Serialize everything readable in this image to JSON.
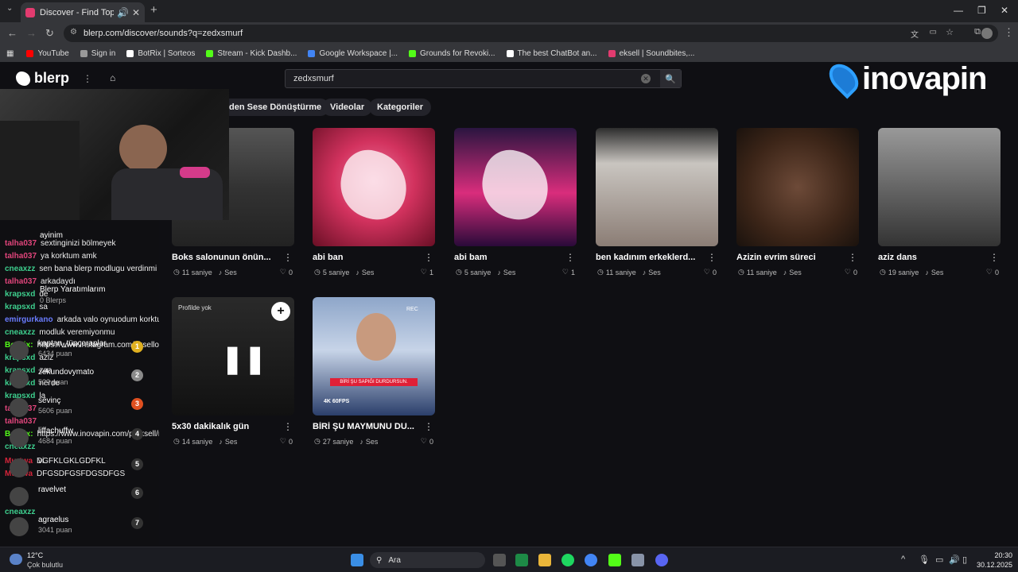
{
  "browser": {
    "tab_title": "Discover - Find Top Blerps,",
    "url": "blerp.com/discover/sounds?q=zedxsmurf",
    "bookmarks": [
      {
        "label": "YouTube",
        "color": "#ff0000"
      },
      {
        "label": "Sign in",
        "color": "#999999"
      },
      {
        "label": "BotRix | Sorteos",
        "color": "#ffffff"
      },
      {
        "label": "Stream - Kick Dashb...",
        "color": "#53fc18"
      },
      {
        "label": "Google Workspace |...",
        "color": "#4285f4"
      },
      {
        "label": "Grounds for Revoki...",
        "color": "#53fc18"
      },
      {
        "label": "The best ChatBot an...",
        "color": "#ffffff"
      },
      {
        "label": "eksell | Soundbites,...",
        "color": "#e23b6f"
      }
    ]
  },
  "site": {
    "logo": "blerp",
    "search_value": "zedxsmurf",
    "pills": [
      "den Sese Dönüştürme",
      "Videolar",
      "Kategoriler"
    ],
    "overlay_brand": "inovapin"
  },
  "cards": [
    {
      "title": "Boks salonunun önün...",
      "duration": "11 saniye",
      "type": "Ses",
      "likes": "0"
    },
    {
      "title": "abi ban",
      "duration": "5 saniye",
      "type": "Ses",
      "likes": "1"
    },
    {
      "title": "abi bam",
      "duration": "5 saniye",
      "type": "Ses",
      "likes": "1"
    },
    {
      "title": "ben kadınım erkeklerd...",
      "duration": "11 saniye",
      "type": "Ses",
      "likes": "0"
    },
    {
      "title": "Azizin evrim süreci",
      "duration": "11 saniye",
      "type": "Ses",
      "likes": "0"
    },
    {
      "title": "aziz dans",
      "duration": "19 saniye",
      "type": "Ses",
      "likes": "0"
    },
    {
      "title": "5x30 dakikalık gün",
      "duration": "14 saniye",
      "type": "Ses",
      "likes": "0",
      "badge": "Profilde yok"
    },
    {
      "title": "BİRİ ŞU MAYMUNU DU...",
      "duration": "27 saniye",
      "type": "Ses",
      "likes": "0",
      "caption": "BİRİ ŞU SAPIĞI DURDURSUN.",
      "res": "4K 60FPS",
      "rec": "REC"
    }
  ],
  "chat": [
    {
      "user": "talha037",
      "msg": "sextinginizi bölmeyek",
      "color": "#e0457b"
    },
    {
      "user": "talha037",
      "msg": "ya korktum amk",
      "color": "#e0457b"
    },
    {
      "user": "cneaxzz",
      "msg": "sen bana blerp modlugu verdinmi",
      "color": "#3ecf8e"
    },
    {
      "user": "talha037",
      "msg": "arkadaydı",
      "color": "#e0457b"
    },
    {
      "user": "krapsxd",
      "msg": "de",
      "color": "#3ecf8e"
    },
    {
      "user": "krapsxd",
      "msg": "sa",
      "color": "#3ecf8e"
    },
    {
      "user": "emirgurkano",
      "msg": "arkada valo oynuodum korktum",
      "color": "#6a7cff"
    },
    {
      "user": "cneaxzz",
      "msg": "modluk veremiyonmu",
      "color": "#3ecf8e"
    },
    {
      "user": "BotRix:",
      "msg": "https://www.instagram.com/eksellol/ Takip etmeyi unutma",
      "color": "#53fc18"
    },
    {
      "user": "krapsxd",
      "msg": "aziz",
      "color": "#3ecf8e"
    },
    {
      "user": "krapsxd",
      "msg": "zaa",
      "color": "#3ecf8e"
    },
    {
      "user": "krapsxd",
      "msg": "nerde",
      "color": "#3ecf8e"
    },
    {
      "user": "krapsxd",
      "msg": "la",
      "color": "#3ecf8e"
    },
    {
      "user": "talha037",
      "msg": "",
      "color": "#e0457b"
    },
    {
      "user": "talha037",
      "msg": "",
      "color": "#e0457b"
    },
    {
      "user": "BotRix:",
      "msg": "https://www.inovapin.com/p/eksell/ref Ucuz Pin için tıkla",
      "color": "#53fc18"
    },
    {
      "user": "cneaxzz",
      "msg": "",
      "color": "#3ecf8e"
    },
    {
      "user": "Murtwa",
      "msg": "DGFKLGKLGDFKL",
      "color": "#d4243a"
    },
    {
      "user": "Murtwa",
      "msg": "DFGSDFGSFDGSDFGS",
      "color": "#d4243a"
    },
    {
      "user": "cneaxzz",
      "msg": "",
      "color": "#3ecf8e"
    }
  ],
  "leaderboard": {
    "header": "Blerp Yaratımlarım",
    "sub": "0 Blerps",
    "rows": [
      {
        "name": "kaptan_tüpçoraplar",
        "points": "6434 puan",
        "rank": "1"
      },
      {
        "name": "zekundovymato",
        "points": "5?? puan",
        "rank": "2"
      },
      {
        "name": "sevinç",
        "points": "5606 puan",
        "rank": "3"
      },
      {
        "name": "liffachuffw",
        "points": "4684 puan",
        "rank": "4"
      },
      {
        "name": "vi",
        "points": "",
        "rank": "5"
      },
      {
        "name": "ravelvet",
        "points": "",
        "rank": "6"
      },
      {
        "name": "agraelus",
        "points": "3041 puan",
        "rank": "7"
      }
    ],
    "top_user": "ayinim"
  },
  "taskbar": {
    "weather_temp": "12°C",
    "weather_desc": "Çok bulutlu",
    "search_label": "Ara",
    "time": "20:30",
    "date": "30.12.2025"
  }
}
